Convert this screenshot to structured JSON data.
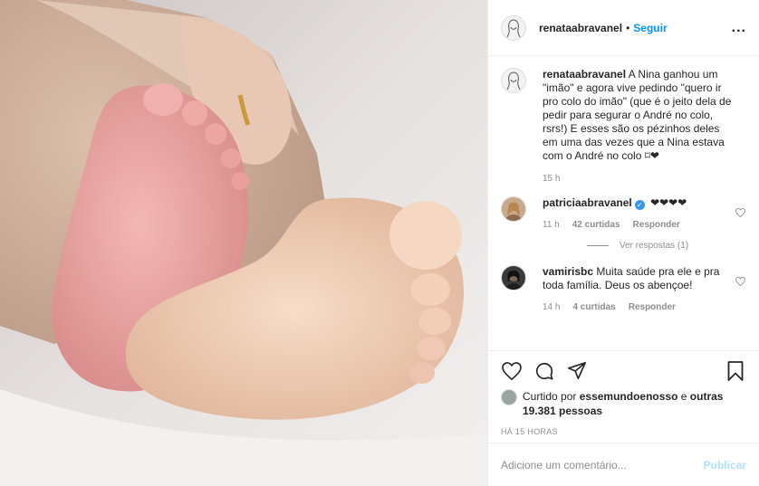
{
  "header": {
    "username": "renataabravanel",
    "separator": "•",
    "follow_label": "Seguir",
    "more_label": "..."
  },
  "caption": {
    "username": "renataabravanel",
    "text": "A Nina ganhou um \"imão\" e agora vive pedindo \"quero ir pro colo do imão\" (que é o jeito dela de pedir para segurar o André no colo, rsrs!) E esses são os pézinhos deles em uma das vezes que a Nina estava com o André no colo ⌑❤",
    "time": "15 h"
  },
  "comments": [
    {
      "username": "patriciaabravanel",
      "verified_mark": "✓",
      "text": "❤❤❤❤",
      "time": "11 h",
      "likes": "42 curtidas",
      "reply_label": "Responder",
      "view_replies": "Ver respostas (1)"
    },
    {
      "username": "vamirisbc",
      "text": "Muita saúde pra ele e pra toda família. Deus os abençoe!",
      "time": "14 h",
      "likes": "4 curtidas",
      "reply_label": "Responder"
    }
  ],
  "actions": {
    "icons": [
      "heart-icon",
      "comment-icon",
      "share-icon",
      "bookmark-icon"
    ]
  },
  "likes": {
    "prefix": "Curtido por",
    "user": "essemundoenosso",
    "middle": "e",
    "others": "outras 19.381 pessoas"
  },
  "posted_ago": "HÁ 15 HORAS",
  "add_comment": {
    "placeholder": "Adicione um comentário...",
    "publish_label": "Publicar"
  },
  "colors": {
    "link": "#0095f6",
    "publish_disabled": "#b2dffc",
    "muted": "#8e8e8e"
  }
}
